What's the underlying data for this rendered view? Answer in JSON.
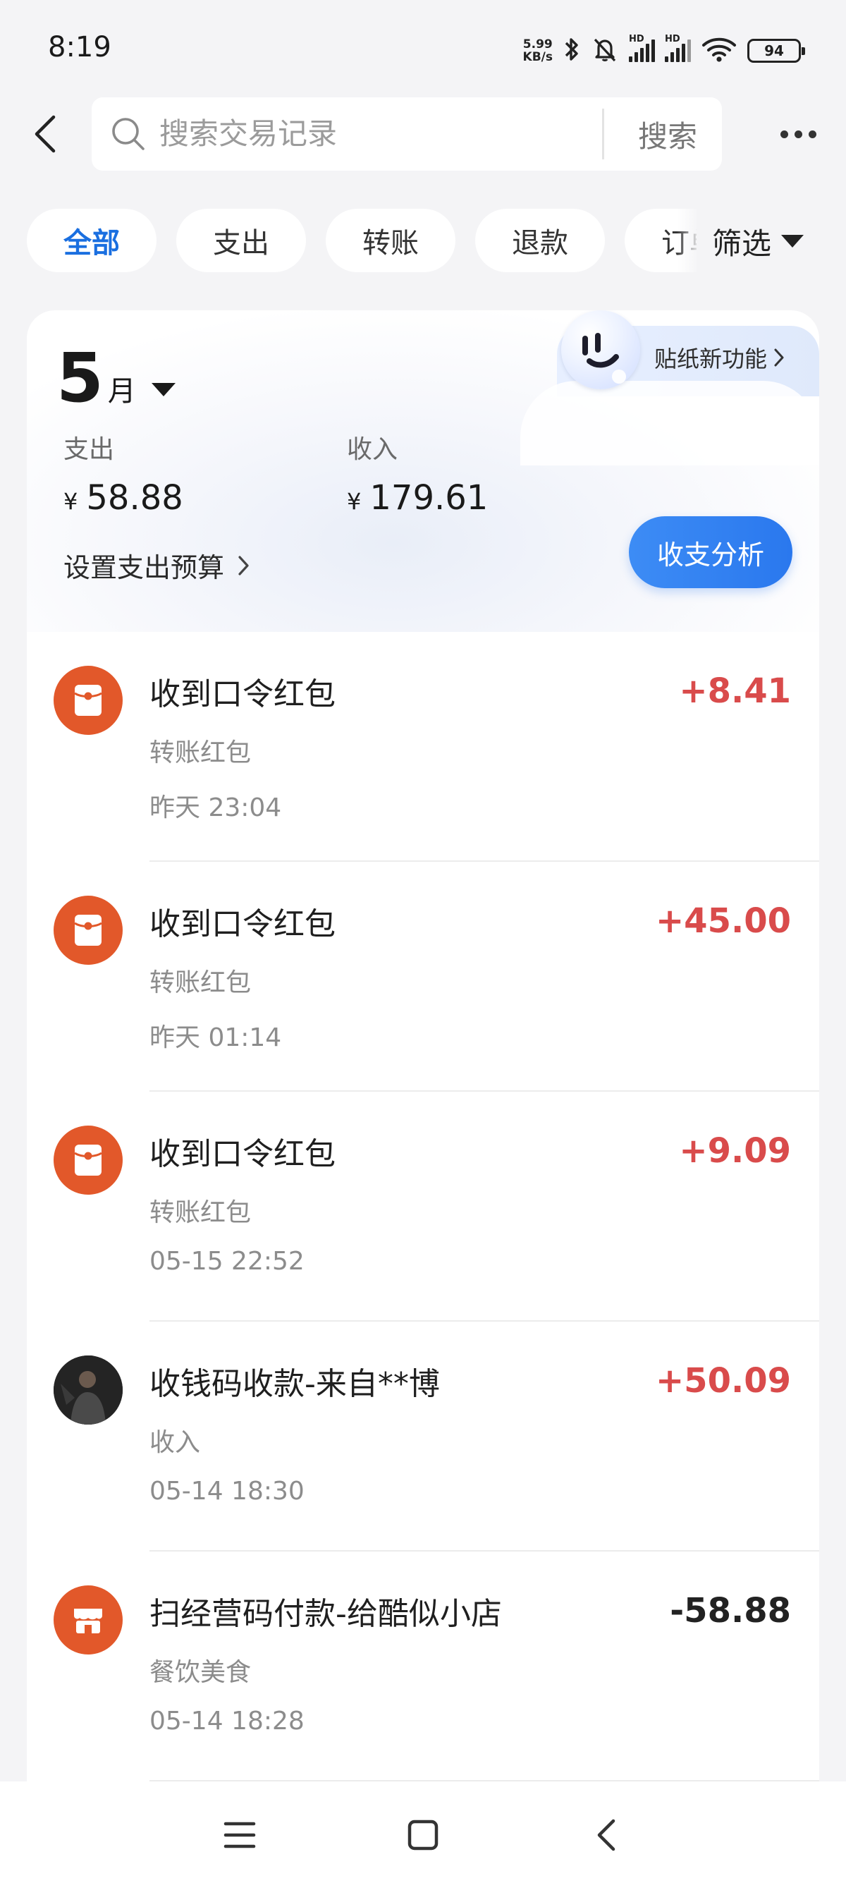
{
  "status_bar": {
    "time": "8:19",
    "net_speed_value": "5.99",
    "net_speed_unit": "KB/s",
    "signal_label": "HD",
    "battery": "94"
  },
  "header": {
    "search_placeholder": "搜索交易记录",
    "search_button": "搜索"
  },
  "filters": {
    "chips": [
      "全部",
      "支出",
      "转账",
      "退款",
      "订单"
    ],
    "active_index": 0,
    "filter_label": "筛选"
  },
  "summary": {
    "month_number": "5",
    "month_unit": "月",
    "sticker_label": "贴纸新功能",
    "expense_label": "支出",
    "expense_currency": "¥",
    "expense_value": "58.88",
    "income_label": "收入",
    "income_currency": "¥",
    "income_value": "179.61",
    "budget_link": "设置支出预算",
    "analysis_button": "收支分析"
  },
  "transactions": [
    {
      "title": "收到口令红包",
      "category": "转账红包",
      "time": "昨天 23:04",
      "amount": "+8.41",
      "icon": "red-packet-icon"
    },
    {
      "title": "收到口令红包",
      "category": "转账红包",
      "time": "昨天 01:14",
      "amount": "+45.00",
      "icon": "red-packet-icon"
    },
    {
      "title": "收到口令红包",
      "category": "转账红包",
      "time": "05-15 22:52",
      "amount": "+9.09",
      "icon": "red-packet-icon"
    },
    {
      "title": "收钱码收款-来自**博",
      "category": "收入",
      "time": "05-14 18:30",
      "amount": "+50.09",
      "icon": "user-avatar"
    },
    {
      "title": "扫经营码付款-给酷似小店",
      "category": "餐饮美食",
      "time": "05-14 18:28",
      "amount": "-58.88",
      "icon": "shop-icon"
    }
  ],
  "colors": {
    "accent_blue": "#1a6fe0",
    "income_red": "#d94b4b",
    "icon_orange": "#e2582a",
    "page_bg": "#f4f4f6"
  }
}
